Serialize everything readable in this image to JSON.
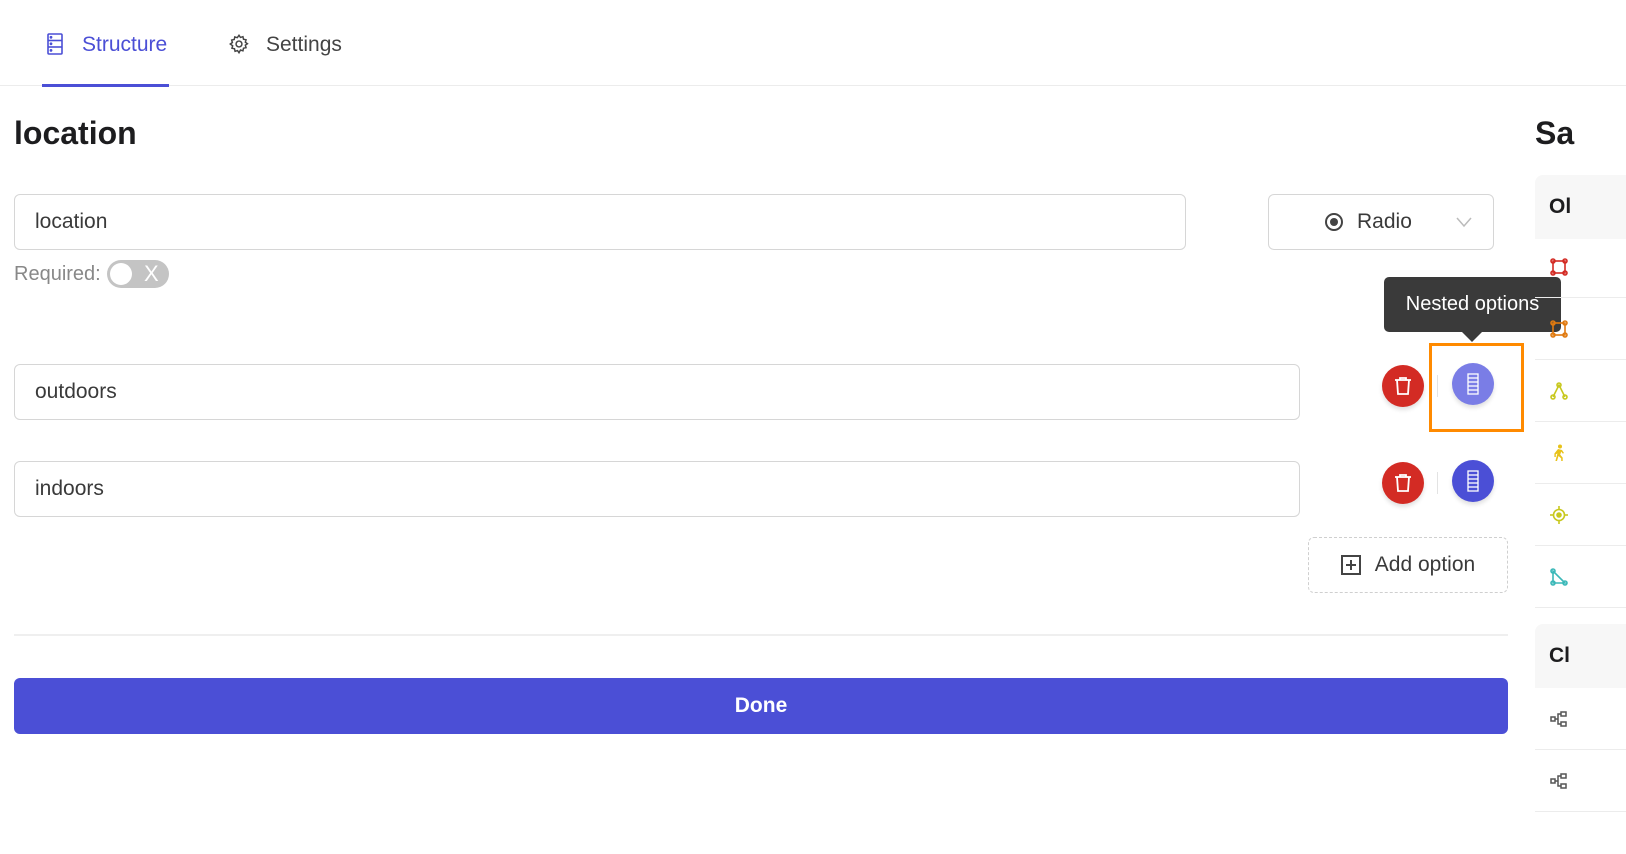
{
  "tabs": [
    {
      "label": "Structure",
      "icon": "structure-icon",
      "active": true
    },
    {
      "label": "Settings",
      "icon": "gear-icon",
      "active": false
    }
  ],
  "editor": {
    "title": "location",
    "name_value": "location",
    "type_select": {
      "icon": "radio-icon",
      "value": "Radio"
    },
    "required_label": "Required:",
    "required_toggle": {
      "state": "off",
      "symbol": "X"
    },
    "options": [
      {
        "value": "outdoors"
      },
      {
        "value": "indoors"
      }
    ],
    "tooltip": "Nested options",
    "add_option_label": "Add option",
    "done_label": "Done"
  },
  "sidebar": {
    "title": "Sa",
    "sections": [
      {
        "label": "Ol",
        "items": [
          {
            "icon": "polygon-icon",
            "color": "#d32b24"
          },
          {
            "icon": "polygon-icon",
            "color": "#e07a10"
          },
          {
            "icon": "polyline-icon",
            "color": "#c8c81e"
          },
          {
            "icon": "walking-person-icon",
            "color": "#e8c21a"
          },
          {
            "icon": "target-point-icon",
            "color": "#c8c81e"
          },
          {
            "icon": "triangle-icon",
            "color": "#3bb8b8"
          }
        ]
      },
      {
        "label": "Cl",
        "items": [
          {
            "icon": "hierarchy-icon",
            "color": "#555555"
          },
          {
            "icon": "hierarchy-icon",
            "color": "#555555"
          }
        ]
      }
    ]
  },
  "colors": {
    "accent": "#4b4fd6",
    "danger": "#d32b24",
    "highlight": "#ff8a00"
  }
}
